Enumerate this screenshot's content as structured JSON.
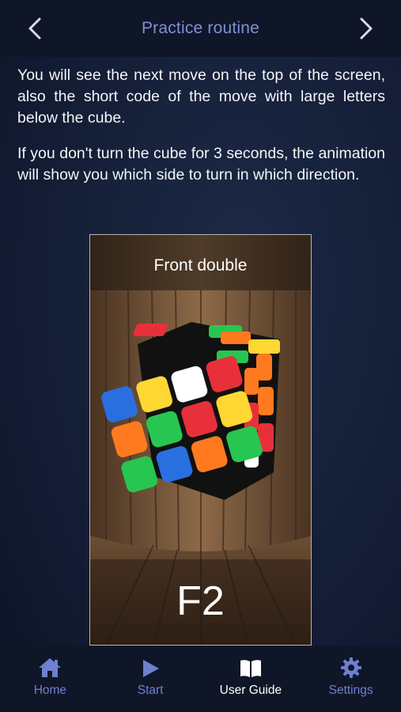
{
  "header": {
    "title": "Practice routine",
    "back_icon": "chevron-left-icon",
    "forward_icon": "chevron-right-icon"
  },
  "content": {
    "paragraph1": "You will see the next move on the top of the screen, also the short code of the move with large letters below the cube.",
    "paragraph2": "If you don't turn the cube for 3 seconds, the animation will show you which side to turn in which direction."
  },
  "preview": {
    "move_name": "Front double",
    "move_code": "F2"
  },
  "tabbar": {
    "items": [
      {
        "label": "Home",
        "icon": "home-icon",
        "active": false
      },
      {
        "label": "Start",
        "icon": "play-icon",
        "active": false
      },
      {
        "label": "User Guide",
        "icon": "book-icon",
        "active": true
      },
      {
        "label": "Settings",
        "icon": "gear-icon",
        "active": false
      }
    ]
  },
  "colors": {
    "accent": "#7f8fd6",
    "header_bg": "#0f1628",
    "tab_inactive": "#6f80cf",
    "tab_active": "#ffffff"
  }
}
